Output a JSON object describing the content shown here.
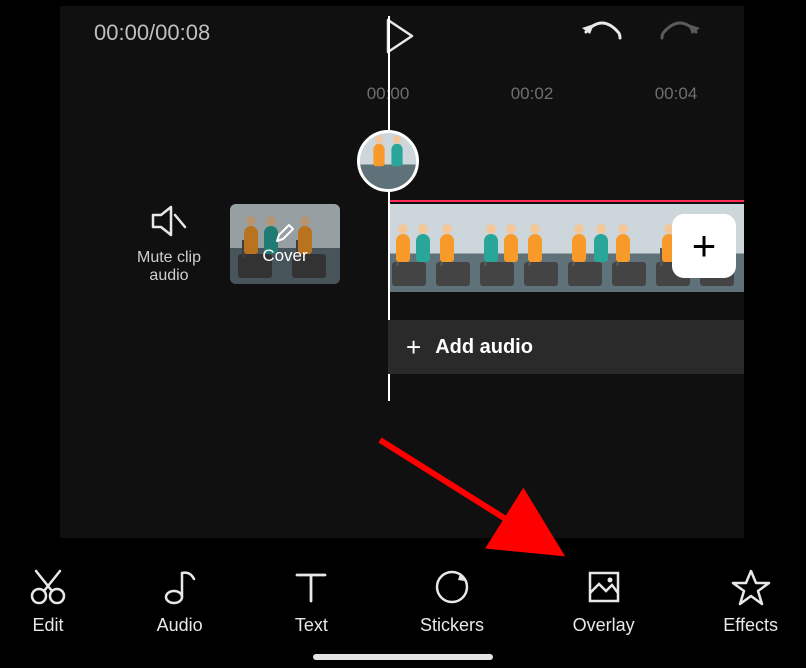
{
  "topbar": {
    "timecode": "00:00/00:08"
  },
  "ruler": {
    "ticks": [
      "00:00",
      "00:02",
      "00:04"
    ]
  },
  "controls": {
    "mute_label_line1": "Mute clip",
    "mute_label_line2": "audio",
    "cover_label": "Cover",
    "add_audio_label": "Add audio"
  },
  "toolbar": {
    "items": [
      {
        "label": "Edit"
      },
      {
        "label": "Audio"
      },
      {
        "label": "Text"
      },
      {
        "label": "Stickers"
      },
      {
        "label": "Overlay"
      },
      {
        "label": "Effects"
      }
    ]
  }
}
